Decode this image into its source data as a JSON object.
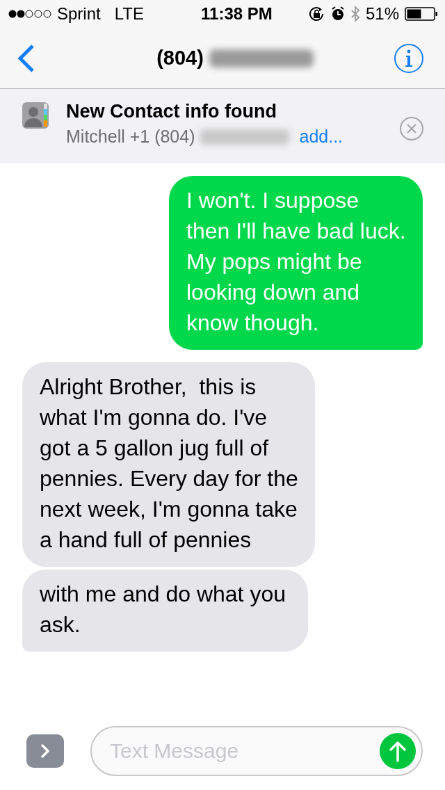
{
  "status_bar": {
    "carrier": "Sprint",
    "network": "LTE",
    "time": "11:38 PM",
    "battery": "51%"
  },
  "nav": {
    "title": "(804)"
  },
  "banner": {
    "title": "New Contact info found",
    "detail": "Mitchell +1 (804)",
    "action": "add..."
  },
  "messages": [
    {
      "kind": "sent",
      "text": "I won't. I suppose then I'll have bad luck.\nMy pops might be looking down and know though.",
      "tail": true
    },
    {
      "kind": "received",
      "text": "Alright Brother,  this is what I'm gonna do. I've got a 5 gallon jug full of pennies. Every day for the next week, I'm gonna take a hand full of pennies",
      "tail": false
    },
    {
      "kind": "received",
      "text": "with me and do what you ask.",
      "tail": true
    }
  ],
  "composer": {
    "placeholder": "Text Message"
  }
}
